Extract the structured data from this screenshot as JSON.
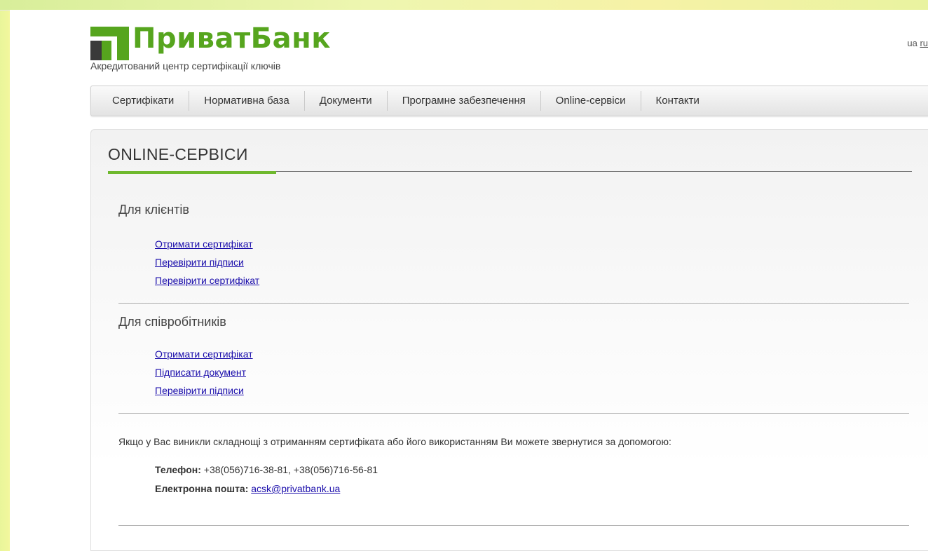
{
  "brand": {
    "name": "ПриватБанк",
    "subtitle": "Акредитований центр сертифікації ключів",
    "color": "#56a51e"
  },
  "lang": {
    "current": "ua",
    "other": "ru"
  },
  "nav": {
    "items": [
      "Сертифікати",
      "Нормативна база",
      "Документи",
      "Програмне забезпечення",
      "Online-сервіси",
      "Контакти"
    ]
  },
  "main": {
    "title": "ONLINE-СЕРВІСИ",
    "sections": [
      {
        "title": "Для клієнтів",
        "links": [
          "Отримати сертифікат",
          "Перевірити підписи",
          "Перевірити сертифікат"
        ]
      },
      {
        "title": "Для співробітників",
        "links": [
          "Отримати сертифікат",
          "Підписати документ",
          "Перевірити підписи"
        ]
      }
    ],
    "help_text": "Якщо у Вас виникли складнощі з отриманням сертифіката або його використанням Ви можете звернутися за допомогою:",
    "contacts": {
      "phone_label": "Телефон:",
      "phone_value": "+38(056)716-38-81, +38(056)716-56-81",
      "email_label": "Електронна пошта:",
      "email_value": "acsk@privatbank.ua"
    }
  },
  "colors": {
    "accent": "#6eb82d",
    "link": "#1a0dab"
  }
}
